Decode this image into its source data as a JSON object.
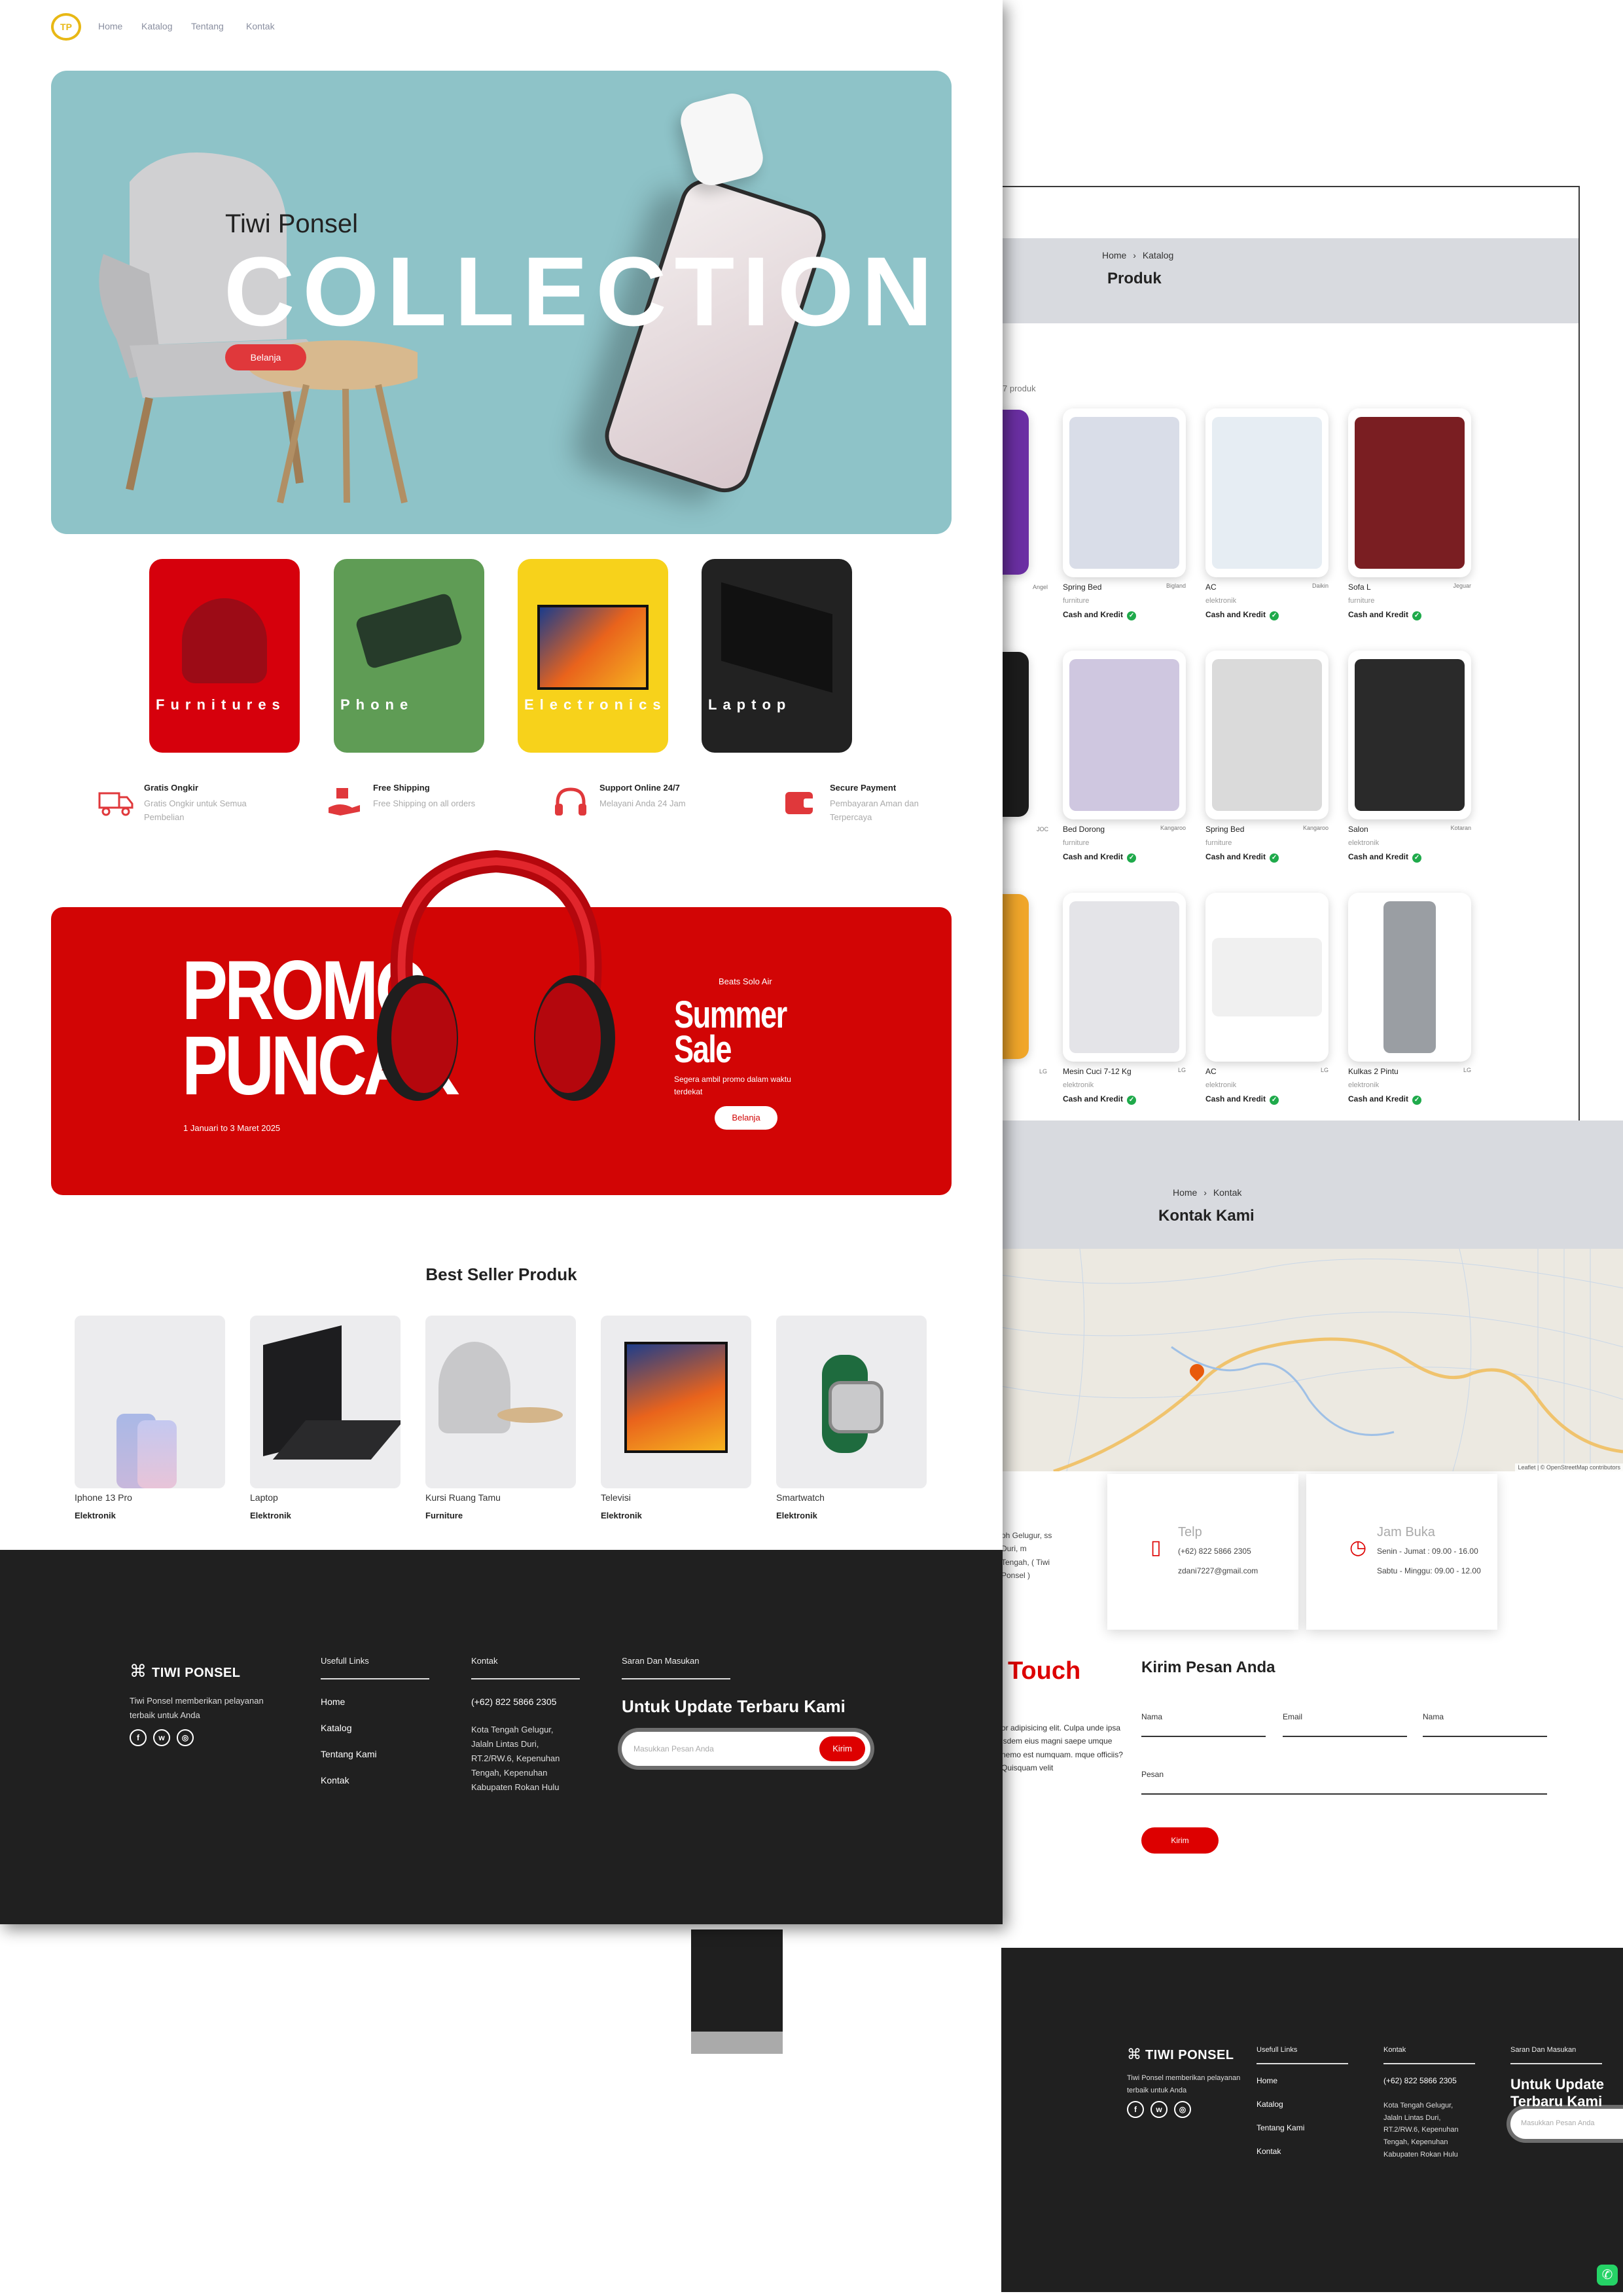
{
  "home": {
    "nav": {
      "logo": "TP",
      "links": [
        "Home",
        "Katalog",
        "Tentang",
        "Kontak"
      ]
    },
    "hero": {
      "brand": "Tiwi Ponsel",
      "headline": "COLLECTION",
      "button": "Belanja"
    },
    "categories": [
      {
        "label": "Furnitures",
        "color": "#d6000c"
      },
      {
        "label": "Phone",
        "color": "#5f9c55"
      },
      {
        "label": "Electronics",
        "color": "#f7d21b"
      },
      {
        "label": "Laptop",
        "color": "#222222"
      }
    ],
    "features": [
      {
        "icon": "truck-icon",
        "title": "Gratis Ongkir",
        "desc": "Gratis Ongkir untuk Semua Pembelian"
      },
      {
        "icon": "shipping-hand-icon",
        "title": "Free Shipping",
        "desc": "Free Shipping on all orders"
      },
      {
        "icon": "headset-icon",
        "title": "Support Online 24/7",
        "desc": "Melayani Anda 24 Jam"
      },
      {
        "icon": "wallet-icon",
        "title": "Secure Payment",
        "desc": "Pembayaran Aman dan Terpercaya"
      }
    ],
    "promo": {
      "headline1": "PROMO",
      "headline2": "PUNCAK",
      "date": "1 Januari to 3 Maret 2025",
      "product": "Beats Solo Air",
      "sale1": "Summer",
      "sale2": "Sale",
      "desc": "Segera ambil promo dalam waktu terdekat",
      "button": "Belanja"
    },
    "best_seller": {
      "title": "Best Seller Produk",
      "items": [
        {
          "name": "Iphone 13 Pro",
          "category": "Elektronik"
        },
        {
          "name": "Laptop",
          "category": "Elektronik"
        },
        {
          "name": "Kursi Ruang Tamu",
          "category": "Furniture"
        },
        {
          "name": "Televisi",
          "category": "Elektronik"
        },
        {
          "name": "Smartwatch",
          "category": "Elektronik"
        }
      ]
    }
  },
  "footer": {
    "brand": "TIWI PONSEL",
    "desc": "Tiwi Ponsel memberikan pelayanan terbaik untuk Anda",
    "social": [
      "facebook-icon",
      "whatsapp-icon",
      "instagram-icon"
    ],
    "links_title": "Usefull Links",
    "links": [
      "Home",
      "Katalog",
      "Tentang Kami",
      "Kontak"
    ],
    "contact_title": "Kontak",
    "phone": "(+62) 822 5866 2305",
    "address": "Kota Tengah Gelugur, Jalaln Lintas Duri, RT.2/RW.6, Kepenuhan Tengah, Kepenuhan Kabupaten Rokan Hulu",
    "news_title": "Saran Dan Masukan",
    "news_heading": "Untuk Update Terbaru Kami",
    "news_placeholder": "Masukkan Pesan Anda",
    "news_button": "Kirim"
  },
  "catalog": {
    "crumb_home": "Home",
    "crumb_sep": "›",
    "crumb_current": "Katalog",
    "title": "Produk",
    "count": "7 produk",
    "payment": "Cash and Kredit",
    "products": [
      {
        "name": "Spring Bed",
        "brand": "Bigland",
        "category": "furniture",
        "color": "#d9dde8"
      },
      {
        "name": "AC",
        "brand": "Daikin",
        "category": "elektronik",
        "color": "#e6edf3"
      },
      {
        "name": "Sofa L",
        "brand": "Jeguar",
        "category": "furniture",
        "color": "#7a1e22"
      },
      {
        "name": "Bed Dorong",
        "brand": "Kangaroo",
        "category": "furniture",
        "color": "#cfc7e0"
      },
      {
        "name": "Spring Bed",
        "brand": "Kangaroo",
        "category": "furniture",
        "color": "#dadada"
      },
      {
        "name": "Salon",
        "brand": "Kotaran",
        "category": "elektronik",
        "color": "#2a2a2a"
      },
      {
        "name": "Mesin Cuci 7-12 Kg",
        "brand": "LG",
        "category": "elektronik",
        "color": "#e4e4e8"
      },
      {
        "name": "AC",
        "brand": "LG",
        "category": "elektronik",
        "color": "#f0f0f0"
      },
      {
        "name": "Kulkas 2 Pintu",
        "brand": "LG",
        "category": "elektronik",
        "color": "#9a9ea3"
      }
    ],
    "left_partial_brands": [
      "Angel",
      "JOC",
      "LG"
    ]
  },
  "contact": {
    "crumb_home": "Home",
    "crumb_sep": "›",
    "crumb_current": "Kontak",
    "title": "Kontak Kami",
    "address_fragment": "oh Gelugur, ss Duri, m Tengah, ( Tiwi Ponsel )",
    "phone_label": "Telp",
    "phone_values": [
      "(+62) 822 5866 2305",
      "zdani7227@gmail.com"
    ],
    "hours_label": "Jam Buka",
    "hours_values": [
      "Senin - Jumat : 09.00 - 16.00",
      "Sabtu - Minggu: 09.00 - 12.00"
    ],
    "touch": "Touch",
    "lorem": "or adipisicing elit. Culpa unde ipsa isdem eius magni saepe umque nemo est numquam. mque officiis? Quisquam velit",
    "form_title": "Kirim Pesan Anda",
    "fields": [
      "Nama",
      "Email",
      "Nama",
      "Pesan"
    ],
    "submit": "Kirim",
    "map_attrib": "Leaflet | © OpenStreetMap contributors"
  },
  "whatsapp_icon": "whatsapp-icon"
}
